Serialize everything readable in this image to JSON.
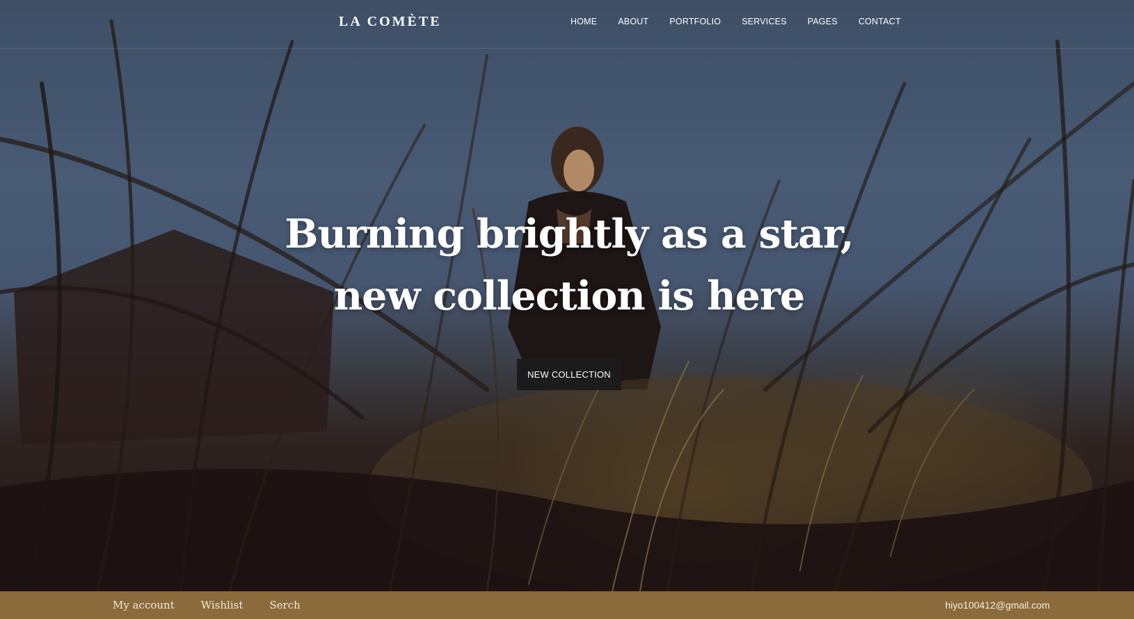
{
  "brand": {
    "logo_text": "LA COMÈTE"
  },
  "nav": {
    "items": [
      {
        "label": "HOME"
      },
      {
        "label": "ABOUT"
      },
      {
        "label": "PORTFOLIO"
      },
      {
        "label": "SERVICES"
      },
      {
        "label": "PAGES"
      },
      {
        "label": "CONTACT"
      }
    ]
  },
  "hero": {
    "headline_line1": "Burning brightly as a star,",
    "headline_line2": "new collection is here",
    "cta_label": "NEW COLLECTION",
    "background_image": "woman-in-tall-grass-at-dusk"
  },
  "footer_bar": {
    "links": [
      {
        "label": "My account"
      },
      {
        "label": "Wishlist"
      },
      {
        "label": "Serch"
      }
    ],
    "email": "hiyo100412@gmail.com"
  },
  "colors": {
    "accent_bar": "#8b6b3c",
    "button_bg": "#1b1b1b",
    "text_light": "#ffffff"
  }
}
